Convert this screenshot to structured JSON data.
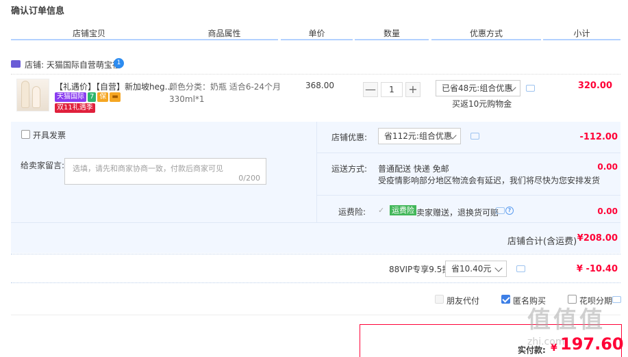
{
  "page_title": "确认订单信息",
  "columns": [
    "店铺宝贝",
    "商品属性",
    "单价",
    "数量",
    "优惠方式",
    "小计"
  ],
  "shop": {
    "label": "店铺: 天猫国际自营萌宝社",
    "badge": "1"
  },
  "product": {
    "title": "【礼遇价】【自营】新加坡heg...",
    "tags": [
      {
        "label": "天猫国际",
        "color": "#8a3cf0"
      },
      {
        "label": "7",
        "color": "#2fb46c"
      },
      {
        "label": "保",
        "color": "#f5a623"
      },
      {
        "label": "▬",
        "color": "#f5a623"
      }
    ],
    "tag2": "双11礼遇季",
    "attr": "颜色分类：奶瓶 适合6-24个月 330ml*1",
    "price": "368.00",
    "quantity": "1",
    "qty_minus": "—",
    "qty_plus": "+",
    "discount_select": "已省48元:组合优惠",
    "discount_note": "买返10元购物金",
    "subtotal": "320.00"
  },
  "invoice": {
    "label": "开具发票"
  },
  "message": {
    "label": "给卖家留言:",
    "placeholder": "选填，请先和商家协商一致，付款后商家可见",
    "counter": "0/200"
  },
  "shop_discount": {
    "label": "店铺优惠:",
    "select": "省112元:组合优惠",
    "value": "-112.00"
  },
  "shipping": {
    "label": "运送方式:",
    "method": "普通配送 快递 免邮",
    "notice": "受疫情影响部分地区物流会有延迟，我们将尽快为您安排发货",
    "value": "0.00"
  },
  "insurance": {
    "label": "运费险:",
    "badge": "运费险",
    "text": "卖家赠送，退换货可赔",
    "help": "?",
    "value": "0.00"
  },
  "shop_total": {
    "label": "店铺合计(含运费)",
    "value": "¥208.00"
  },
  "vip": {
    "label": "88VIP专享9.5折",
    "select": "省10.40元",
    "value": "¥ -10.40"
  },
  "options": {
    "friend_pay": "朋友代付",
    "anonymous": "匿名购买",
    "huabei": "花呗分期"
  },
  "final": {
    "label": "实付款:",
    "currency": "¥",
    "value": "197.60"
  },
  "watermark": "值值值",
  "watermark_site": "zhi.com"
}
